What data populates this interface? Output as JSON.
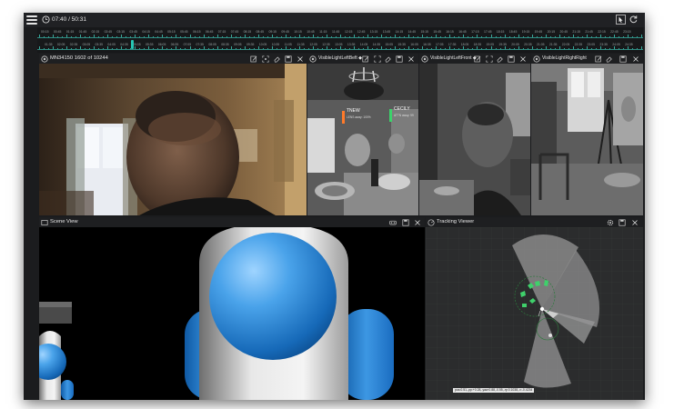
{
  "topbar": {
    "menu_icon": "hamburger-menu-icon",
    "time_icon": "clock-icon",
    "time_text": "07:40 / 50:31",
    "controls": [
      "cursor-icon",
      "refresh-icon"
    ]
  },
  "timeline": {
    "row1_labels": [
      "00:15",
      "00:45",
      "01:15",
      "01:45",
      "02:15",
      "02:45",
      "03:15",
      "03:45",
      "04:15",
      "04:45",
      "05:15",
      "05:45",
      "06:15",
      "06:45",
      "07:15",
      "07:45",
      "08:15",
      "08:45",
      "09:15",
      "09:45",
      "10:15",
      "10:45",
      "11:15",
      "11:45",
      "12:15",
      "12:45",
      "13:15",
      "13:45",
      "14:15",
      "14:45",
      "15:15",
      "15:45",
      "16:15",
      "16:45",
      "17:15",
      "17:45",
      "18:15",
      "18:45",
      "19:15",
      "19:45",
      "20:15",
      "20:45",
      "21:15",
      "21:45",
      "22:15",
      "22:45",
      "23:15"
    ],
    "row2_labels": [
      "01:35",
      "02:05",
      "02:35",
      "03:05",
      "03:35",
      "04:05",
      "04:35",
      "05:05",
      "05:35",
      "06:05",
      "06:35",
      "07:05",
      "07:35",
      "08:05",
      "08:35",
      "09:05",
      "09:35",
      "10:05",
      "10:35",
      "11:05",
      "11:35",
      "12:05",
      "12:35",
      "13:05",
      "13:35",
      "14:05",
      "14:35",
      "15:05",
      "15:35",
      "16:05",
      "16:35",
      "17:05",
      "17:35",
      "18:05",
      "18:35",
      "19:05",
      "19:35",
      "20:05",
      "20:35",
      "21:05",
      "21:35",
      "22:05",
      "22:35",
      "23:05",
      "23:35",
      "24:05",
      "24:35"
    ],
    "accent": "#26c6b3",
    "position_fraction": 0.155
  },
  "panes": {
    "main": {
      "title": "MN34150 1602 of 10244",
      "icon": "camera-icon",
      "controls": [
        "edit-icon",
        "fit-icon",
        "erase-icon",
        "save-icon",
        "close-icon"
      ]
    },
    "cam_left": {
      "title": "VisibleLightLeftBeft ◆",
      "icon": "camera-icon",
      "controls": [
        "edit-icon",
        "fit-icon",
        "erase-icon",
        "save-icon",
        "close-icon"
      ]
    },
    "cam_front": {
      "title": "VisibleLightLeftFront ◆",
      "icon": "camera-icon",
      "controls": [
        "edit-icon",
        "fit-icon",
        "erase-icon",
        "save-icon",
        "close-icon"
      ]
    },
    "cam_right": {
      "title": "VisibleLightRightRight",
      "icon": "camera-icon",
      "controls": [
        "edit-icon",
        "fit-icon",
        "erase-icon",
        "save-icon",
        "close-icon"
      ]
    },
    "scene": {
      "title": "Scene View",
      "icon": "scene-view-icon",
      "controls": [
        "vr-icon",
        "save-icon",
        "close-icon"
      ]
    },
    "tracking": {
      "title": "Tracking Viewer",
      "icon": "tracking-icon",
      "controls": [
        "settings-icon",
        "save-icon",
        "close-icon"
      ]
    }
  },
  "overlays": {
    "tag_new": "TNEW",
    "tag_new_sub": "LENS away: 100%",
    "tag_cecily": "CECILY",
    "tag_cecily_sub": "ATTN away: 99"
  },
  "tracking_status": "pos:0.51,-pp:+0.28,-yaw:0.88,-0.55,-rp:0.1038,-x:-0.4234"
}
